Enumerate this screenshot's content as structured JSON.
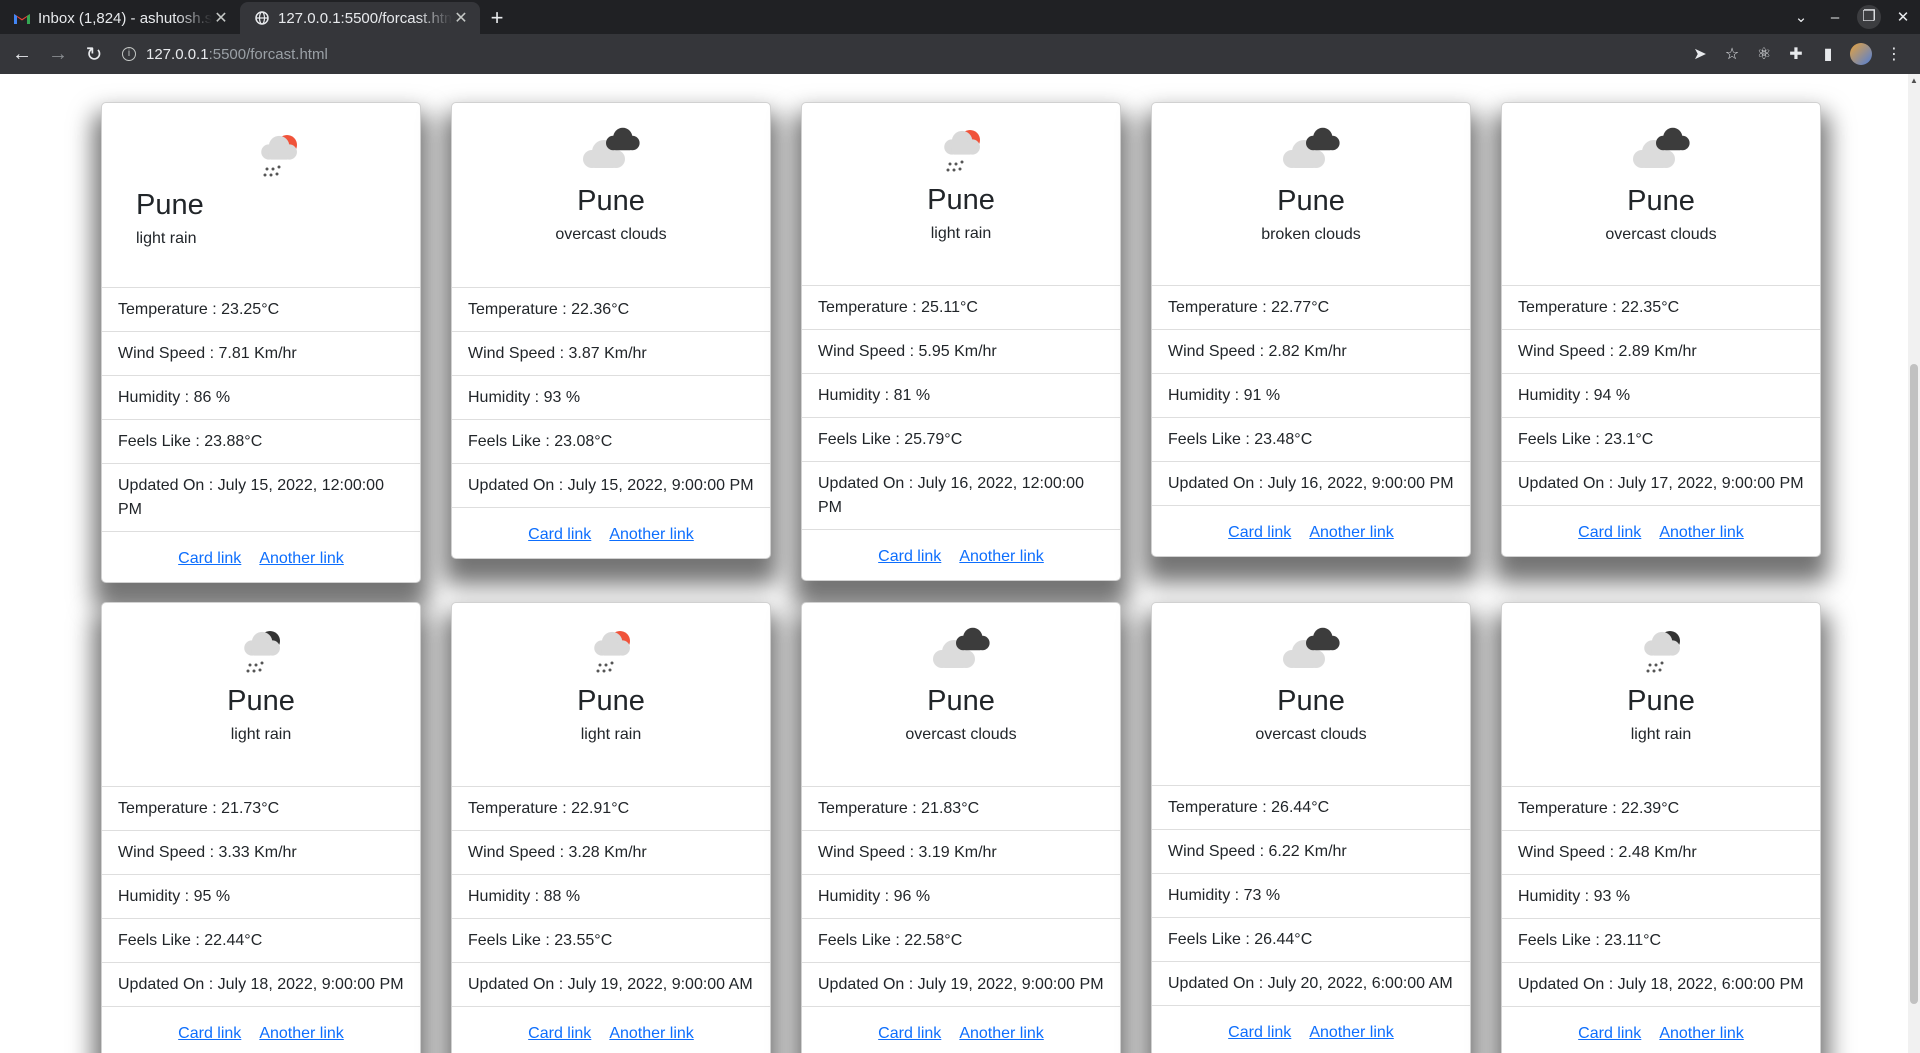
{
  "browser": {
    "tabs": [
      {
        "title": "Inbox (1,824) - ashutosh.s",
        "favicon": "gmail-icon",
        "active": false
      },
      {
        "title": "127.0.0.1:5500/forcast.html",
        "favicon": "globe-icon",
        "active": true
      }
    ],
    "url_host": "127.0.0.1",
    "url_path": ":5500/forcast.html"
  },
  "labels": {
    "temperature": "Temperature : ",
    "wind": "Wind Speed : ",
    "humidity": "Humidity : ",
    "feels": "Feels Like : ",
    "updated": "Updated On : ",
    "card_link": "Card link",
    "another_link": "Another link"
  },
  "cards": [
    {
      "city": "Pune",
      "desc": "light rain",
      "icon": "rain-sun-icon",
      "temp": "23.25°C",
      "wind": "7.81 Km/hr",
      "humidity": "86 %",
      "feels": "23.88°C",
      "updated": "July 15, 2022, 12:00:00 PM"
    },
    {
      "city": "Pune",
      "desc": "overcast clouds",
      "icon": "overcast-clouds-icon",
      "temp": "22.36°C",
      "wind": "3.87 Km/hr",
      "humidity": "93 %",
      "feels": "23.08°C",
      "updated": "July 15, 2022, 9:00:00 PM"
    },
    {
      "city": "Pune",
      "desc": "light rain",
      "icon": "rain-sun-icon",
      "temp": "25.11°C",
      "wind": "5.95 Km/hr",
      "humidity": "81 %",
      "feels": "25.79°C",
      "updated": "July 16, 2022, 12:00:00 PM"
    },
    {
      "city": "Pune",
      "desc": "broken clouds",
      "icon": "broken-clouds-icon",
      "temp": "22.77°C",
      "wind": "2.82 Km/hr",
      "humidity": "91 %",
      "feels": "23.48°C",
      "updated": "July 16, 2022, 9:00:00 PM"
    },
    {
      "city": "Pune",
      "desc": "overcast clouds",
      "icon": "overcast-clouds-icon",
      "temp": "22.35°C",
      "wind": "2.89 Km/hr",
      "humidity": "94 %",
      "feels": "23.1°C",
      "updated": "July 17, 2022, 9:00:00 PM"
    },
    {
      "city": "Pune",
      "desc": "light rain",
      "icon": "rain-night-icon",
      "temp": "21.73°C",
      "wind": "3.33 Km/hr",
      "humidity": "95 %",
      "feels": "22.44°C",
      "updated": "July 18, 2022, 9:00:00 PM"
    },
    {
      "city": "Pune",
      "desc": "light rain",
      "icon": "rain-sun-icon",
      "temp": "22.91°C",
      "wind": "3.28 Km/hr",
      "humidity": "88 %",
      "feels": "23.55°C",
      "updated": "July 19, 2022, 9:00:00 AM"
    },
    {
      "city": "Pune",
      "desc": "overcast clouds",
      "icon": "overcast-clouds-icon",
      "temp": "21.83°C",
      "wind": "3.19 Km/hr",
      "humidity": "96 %",
      "feels": "22.58°C",
      "updated": "July 19, 2022, 9:00:00 PM"
    },
    {
      "city": "Pune",
      "desc": "overcast clouds",
      "icon": "overcast-clouds-icon",
      "temp": "26.44°C",
      "wind": "6.22 Km/hr",
      "humidity": "73 %",
      "feels": "26.44°C",
      "updated": "July 20, 2022, 6:00:00 AM"
    },
    {
      "city": "Pune",
      "desc": "light rain",
      "icon": "rain-night-icon",
      "temp": "22.39°C",
      "wind": "2.48 Km/hr",
      "humidity": "93 %",
      "feels": "23.11°C",
      "updated": "July 18, 2022, 6:00:00 PM"
    }
  ]
}
